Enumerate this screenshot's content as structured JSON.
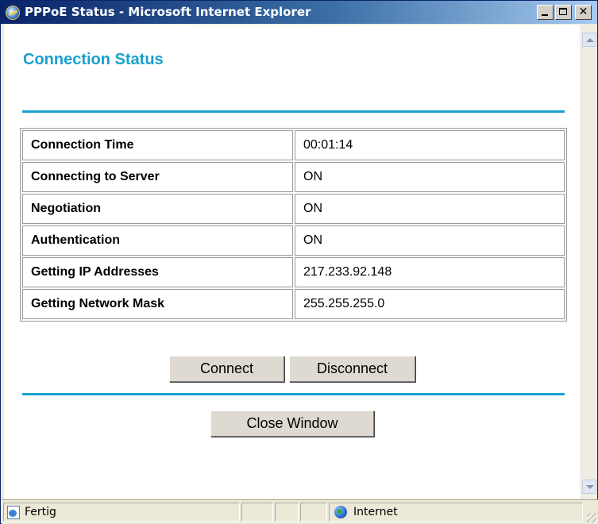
{
  "window": {
    "title": "PPPoE Status - Microsoft Internet Explorer"
  },
  "page": {
    "heading": "Connection Status",
    "rows": [
      {
        "label": "Connection Time",
        "value": "00:01:14"
      },
      {
        "label": "Connecting to Server",
        "value": "ON"
      },
      {
        "label": "Negotiation",
        "value": "ON"
      },
      {
        "label": "Authentication",
        "value": "ON"
      },
      {
        "label": "Getting IP Addresses",
        "value": "217.233.92.148"
      },
      {
        "label": "Getting Network Mask",
        "value": "255.255.255.0"
      }
    ],
    "buttons": {
      "connect": "Connect",
      "disconnect": "Disconnect",
      "close_window": "Close Window"
    }
  },
  "statusbar": {
    "status_text": "Fertig",
    "zone": "Internet"
  },
  "colors": {
    "accent": "#1aa0cf",
    "titlebar": "#0a246a"
  },
  "icons": [
    "ie-app-icon",
    "minimize-icon",
    "maximize-icon",
    "close-icon",
    "scroll-up-icon",
    "scroll-down-icon",
    "page-icon",
    "globe-icon"
  ]
}
